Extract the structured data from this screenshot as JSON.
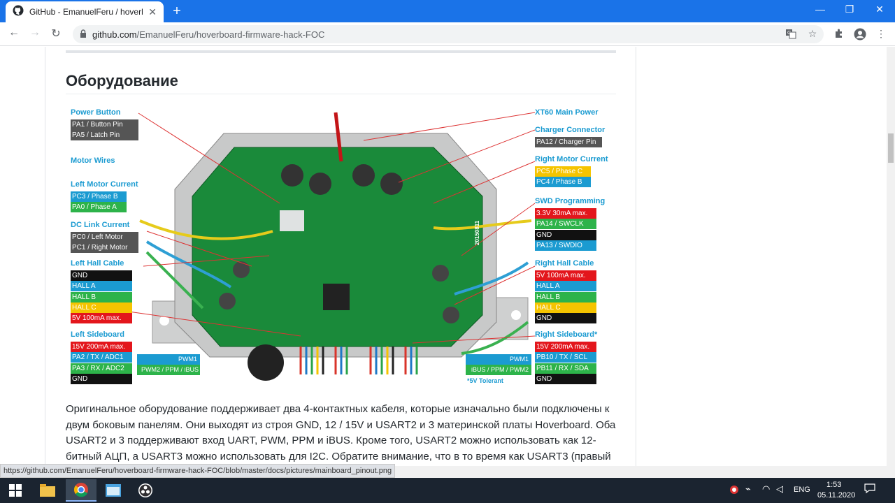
{
  "tab": {
    "title": "GitHub - EmanuelFeru / hoverbo",
    "close": "✕",
    "new": "+"
  },
  "window": {
    "minimize": "—",
    "maximize": "❐",
    "close": "✕"
  },
  "omnibox": {
    "domain": "github.com",
    "path": "/EmanuelFeru/hoverboard-firmware-hack-FOC"
  },
  "article": {
    "heading": "Оборудование",
    "paragraph": "Оригинальное оборудование поддерживает два 4-контактных кабеля, которые изначально были подключены к двум боковым панелям. Они выходят из строя GND, 12 / 15V и USART2 и 3 материнской платы Hoverboard. Оба USART2 и 3 поддерживают вход UART, PWM, PPM и iBUS. Кроме того, USART2 можно использовать как 12-битный АЦП, а USART3 можно использовать для I2C. Обратите внимание, что в то время как USART3 (правый"
  },
  "diagram": {
    "left": [
      {
        "title": "Power Button",
        "pins": [
          {
            "text": "PA1 / Button Pin",
            "color": "#555"
          },
          {
            "text": "PA5 / Latch Pin",
            "color": "#555"
          }
        ]
      },
      {
        "title": "Motor Wires",
        "pins": []
      },
      {
        "title": "Left Motor Current",
        "pins": [
          {
            "text": "PC3 / Phase B",
            "color": "#1b9bd1"
          },
          {
            "text": "PA0 / Phase A",
            "color": "#2db34a"
          }
        ]
      },
      {
        "title": "DC Link Current",
        "pins": [
          {
            "text": "PC0 / Left Motor",
            "color": "#555"
          },
          {
            "text": "PC1 / Right Motor",
            "color": "#555"
          }
        ]
      },
      {
        "title": "Left Hall Cable",
        "pins": [
          {
            "text": "GND",
            "color": "#111"
          },
          {
            "text": "HALL A",
            "color": "#1b9bd1"
          },
          {
            "text": "HALL B",
            "color": "#2db34a"
          },
          {
            "text": "HALL C",
            "color": "#f5c400"
          },
          {
            "text": "5V 100mA max.",
            "color": "#e3161c"
          }
        ]
      },
      {
        "title": "Left Sideboard",
        "pins": [
          {
            "text": "15V 200mA max.",
            "color": "#e3161c"
          },
          {
            "text": "PA2 / TX / ADC1",
            "color": "#1b9bd1"
          },
          {
            "text": "PA3 / RX / ADC2",
            "color": "#2db34a"
          },
          {
            "text": "GND",
            "color": "#111"
          }
        ]
      }
    ],
    "left_extra": {
      "pwm1": "PWM1",
      "pwm2": "PWM2 / PPM / iBUS"
    },
    "right": [
      {
        "title": "XT60 Main Power",
        "pins": []
      },
      {
        "title": "Charger Connector",
        "pins": [
          {
            "text": "PA12 / Charger Pin",
            "color": "#555"
          }
        ]
      },
      {
        "title": "Right Motor Current",
        "pins": [
          {
            "text": "PC5 / Phase C",
            "color": "#f5c400"
          },
          {
            "text": "PC4 / Phase B",
            "color": "#1b9bd1"
          }
        ]
      },
      {
        "title": "SWD Programming",
        "pins": [
          {
            "text": "3.3V 30mA max.",
            "color": "#e3161c"
          },
          {
            "text": "PA14 / SWCLK",
            "color": "#2db34a"
          },
          {
            "text": "GND",
            "color": "#111"
          },
          {
            "text": "PA13 / SWDIO",
            "color": "#1b9bd1"
          }
        ]
      },
      {
        "title": "Right Hall Cable",
        "pins": [
          {
            "text": "5V 100mA max.",
            "color": "#e3161c"
          },
          {
            "text": "HALL A",
            "color": "#1b9bd1"
          },
          {
            "text": "HALL B",
            "color": "#2db34a"
          },
          {
            "text": "HALL C",
            "color": "#f5c400"
          },
          {
            "text": "GND",
            "color": "#111"
          }
        ]
      },
      {
        "title": "Right Sideboard*",
        "pins": [
          {
            "text": "15V 200mA max.",
            "color": "#e3161c"
          },
          {
            "text": "PB10 / TX / SCL",
            "color": "#1b9bd1"
          },
          {
            "text": "PB11 / RX / SDA",
            "color": "#2db34a"
          },
          {
            "text": "GND",
            "color": "#111"
          }
        ]
      }
    ],
    "right_extra": {
      "pwm1": "PWM1",
      "pwm2": "iBUS / PPM / PWM2",
      "tolerant": "*5V Tolerant"
    },
    "board_marking": "20150811"
  },
  "statusbar": "https://github.com/EmanuelFeru/hoverboard-firmware-hack-FOC/blob/master/docs/pictures/mainboard_pinout.png",
  "tray": {
    "lang": "ENG",
    "time": "1:53",
    "date": "05.11.2020"
  }
}
